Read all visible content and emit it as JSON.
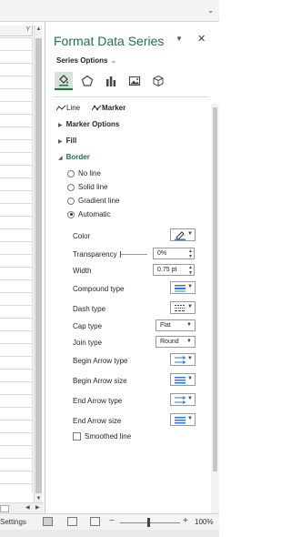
{
  "colors": {
    "accent": "#217346",
    "link": "#2b79d8"
  },
  "sheet": {
    "column_header": "Y"
  },
  "statusbar": {
    "settings": "Settings",
    "zoom": "100%",
    "zoom_minus": "−",
    "zoom_plus": "+"
  },
  "pane": {
    "title": "Format Data Series",
    "series_options": "Series Options",
    "series_options_icon": "chevron-down-icon",
    "icon_tabs": [
      "fill-line-icon",
      "effects-pentagon-icon",
      "series-options-bars-icon",
      "picture-icon",
      "3d-cube-icon"
    ],
    "line_tab": "Line",
    "marker_tab": "Marker",
    "sections": {
      "marker_options": "Marker Options",
      "fill": "Fill",
      "border": "Border"
    },
    "border": {
      "options": [
        "No line",
        "Solid line",
        "Gradient line",
        "Automatic"
      ],
      "selected": "Automatic",
      "color_label": "Color",
      "transparency_label": "Transparency",
      "transparency_value": "0%",
      "transparency_level": 0,
      "width_label": "Width",
      "width_value": "0.75 pt",
      "compound_label": "Compound type",
      "dash_label": "Dash type",
      "cap_label": "Cap type",
      "cap_value": "Flat",
      "join_label": "Join type",
      "join_value": "Round",
      "begin_arrow_type": "Begin Arrow type",
      "begin_arrow_size": "Begin Arrow size",
      "end_arrow_type": "End Arrow type",
      "end_arrow_size": "End Arrow size",
      "smoothed_line": "Smoothed line"
    }
  }
}
